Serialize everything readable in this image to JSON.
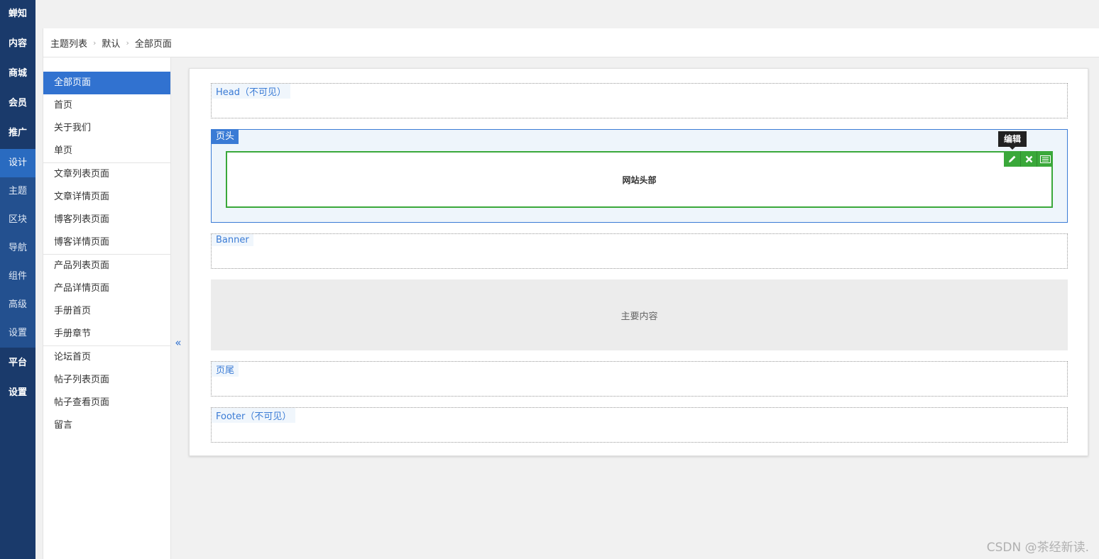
{
  "leftnav": {
    "items": [
      {
        "label": "蝉知",
        "type": "top"
      },
      {
        "label": "内容",
        "type": "top"
      },
      {
        "label": "商城",
        "type": "top"
      },
      {
        "label": "会员",
        "type": "top"
      },
      {
        "label": "推广",
        "type": "top"
      },
      {
        "label": "设计",
        "type": "active"
      },
      {
        "label": "主题",
        "type": "sub"
      },
      {
        "label": "区块",
        "type": "sub"
      },
      {
        "label": "导航",
        "type": "sub"
      },
      {
        "label": "组件",
        "type": "sub"
      },
      {
        "label": "高级",
        "type": "sub"
      },
      {
        "label": "设置",
        "type": "sub"
      },
      {
        "label": "平台",
        "type": "top"
      },
      {
        "label": "设置",
        "type": "top"
      }
    ]
  },
  "breadcrumb": {
    "items": [
      "主题列表",
      "默认",
      "全部页面"
    ],
    "separator": "›"
  },
  "subnav": {
    "groups": [
      [
        "全部页面",
        "首页",
        "关于我们",
        "单页"
      ],
      [
        "文章列表页面",
        "文章详情页面",
        "博客列表页面",
        "博客详情页面"
      ],
      [
        "产品列表页面",
        "产品详情页面",
        "手册首页",
        "手册章节"
      ],
      [
        "论坛首页",
        "帖子列表页面",
        "帖子查看页面",
        "留言"
      ]
    ],
    "active": "全部页面",
    "collapse_icon": "«"
  },
  "layout": {
    "head_label": "Head（不可见）",
    "header_label": "页头",
    "header_block": "网站头部",
    "tooltip": "编辑",
    "banner_label": "Banner",
    "main_label": "主要内容",
    "footer_cn_label": "页尾",
    "footer_label": "Footer（不可见）"
  },
  "colors": {
    "nav_bg": "#1a3a6b",
    "accent": "#3172d0",
    "block_border": "#3aa83a"
  },
  "watermark": "CSDN @茶经新读."
}
